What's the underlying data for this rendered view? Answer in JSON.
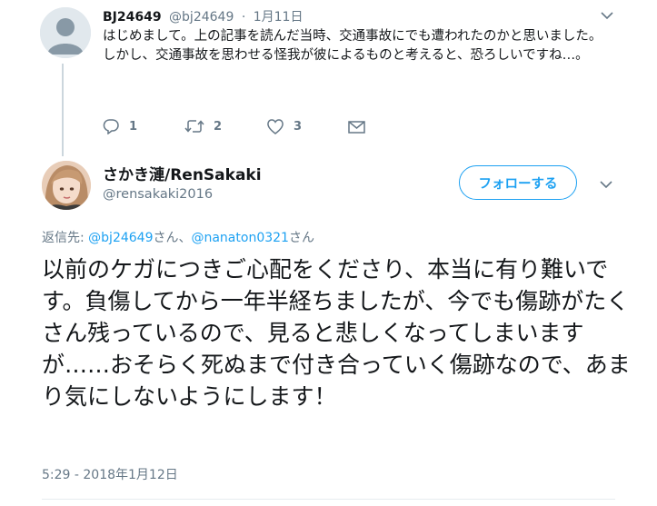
{
  "reply_tweet": {
    "author_name": "BJ24649",
    "author_handle": "@bj24649",
    "separator": "·",
    "date": "1月11日",
    "text_lines": [
      "はじめまして。上の記事を読んだ当時、交通事故にでも遭われたのかと思いました。",
      "しかし、交通事故を思わせる怪我が彼によるものと考えると、恐ろしいですね…。"
    ],
    "actions": {
      "reply_count": "1",
      "retweet_count": "2",
      "like_count": "3"
    }
  },
  "main_tweet": {
    "author_name": "さかき漣/RenSakaki",
    "author_handle": "@rensakaki2016",
    "follow_label": "フォローする",
    "replying_prefix": "返信先: ",
    "replying_to_1": "@bj24649",
    "replying_suffix_1": "さん、",
    "replying_to_2": "@nanaton0321",
    "replying_suffix_2": "さん",
    "text": "以前のケガにつきご心配をくださり、本当に有り難いです。負傷してから一年半経ちましたが、今でも傷跡がたくさん残っているので、見ると悲しくなってしまいますが……おそらく死ぬまで付き合っていく傷跡なので、あまり気にしないようにします！",
    "timestamp": "5:29 - 2018年1月12日"
  },
  "colors": {
    "accent": "#1da1f2",
    "secondary_text": "#657786",
    "primary_text": "#14171a"
  },
  "icons": {
    "reply": "reply-icon",
    "retweet": "retweet-icon",
    "like": "heart-icon",
    "dm": "envelope-icon",
    "menu": "chevron-down-icon"
  }
}
